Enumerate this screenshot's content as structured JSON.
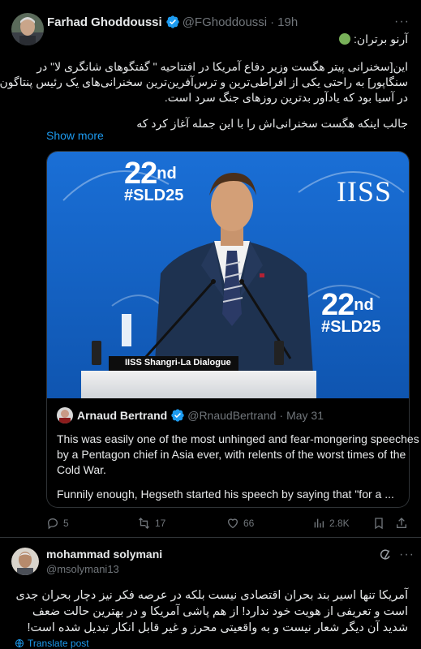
{
  "tweet": {
    "author_name": "Farhad Ghoddoussi",
    "handle": "@FGhoddoussi",
    "separator": "·",
    "time": "19h",
    "more": "···",
    "lines": [
      "آرنو برتران:",
      "این[سخنرانی پیتر هگست وزیر دفاع آمریکا در  افتتاحیه \" گفتگوهای شانگری لا\" در",
      "سنگاپور] به راحتی یکی از افراطی‌ترین و ترس‌آفرین‌ترین سخنرانی‌های یک رئیس پنتاگون",
      "در آسیا بود که یادآور بدترین روزهای جنگ سرد است.",
      "جالب اینکه هگست سخنرانی‌اش را با این جمله آغاز کرد که"
    ],
    "show_more": "Show more",
    "media": {
      "left_logo_num": "22",
      "left_logo_sup": "nd",
      "left_logo_tag": "#SLD25",
      "iiss": "IISS",
      "right_logo_num": "22",
      "right_logo_sup": "nd",
      "right_logo_tag": "#SLD25",
      "podium_label": "IISS Shangri-La Dialogue"
    },
    "quote": {
      "author_name": "Arnaud Bertrand",
      "handle": "@RnaudBertrand",
      "separator": "·",
      "date": "May 31",
      "lines": [
        "This was easily one of the most unhinged and fear-mongering speeches",
        "by a Pentagon chief in Asia ever, with relents of the worst times of the",
        "Cold War.",
        "Funnily enough, Hegseth started his speech by saying that \"for a ..."
      ]
    },
    "actions": {
      "replies": "5",
      "reposts": "17",
      "likes": "66",
      "views": "2.8K"
    }
  },
  "reply": {
    "author_name": "mohammad solymani",
    "handle": "@msolymani13",
    "more": "···",
    "lines": [
      "آمریکا تنها اسیر بند بحران اقتصادی نیست بلکه در عرصه فکر نیز دچار بحران جدی",
      "است و تعریفی از هویت خود ندارد! از هم پاشی آمریکا و در بهترین حالت ضعف",
      "شدید آن دیگر شعار نیست و به واقعیتی  محرز و غیر قابل انکار تبدیل شده است!"
    ],
    "translate": "Translate post"
  },
  "colors": {
    "background": "#000000",
    "text": "#e7e9ea",
    "muted": "#71767b",
    "link": "#1d9bf0",
    "border": "#2f3336",
    "stage_blue": "#1565c8"
  }
}
